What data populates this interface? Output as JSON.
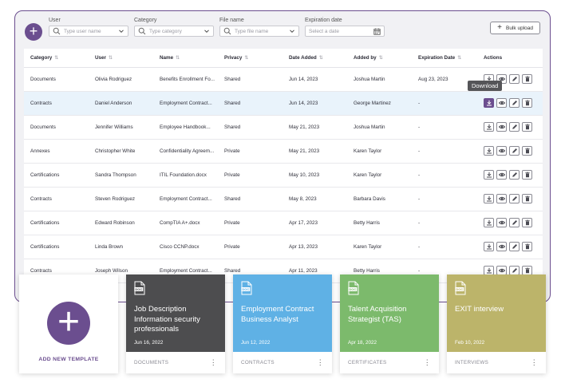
{
  "filters": {
    "user": {
      "label": "User",
      "placeholder": "Type user name"
    },
    "category": {
      "label": "Category",
      "placeholder": "Type category"
    },
    "file_name": {
      "label": "File name",
      "placeholder": "Type file name"
    },
    "expiration": {
      "label": "Expiration date",
      "placeholder": "Select a date"
    }
  },
  "bulk_upload_label": "Bulk upload",
  "columns": [
    "Category",
    "User",
    "Name",
    "Privacy",
    "Date Added",
    "Added by",
    "Expiration Date",
    "Actions"
  ],
  "rows": [
    {
      "category": "Documents",
      "user": "Olivia Rodriguez",
      "name": "Benefits Enrollment Fo...",
      "privacy": "Shared",
      "date_added": "Jun 14, 2023",
      "added_by": "Joshua Martin",
      "expiration": "Aug 23, 2023"
    },
    {
      "category": "Contracts",
      "user": "Daniel Anderson",
      "name": "Employment Contract...",
      "privacy": "Shared",
      "date_added": "Jun 14, 2023",
      "added_by": "George Martinez",
      "expiration": "-"
    },
    {
      "category": "Documents",
      "user": "Jennifer Williams",
      "name": "Employee Handbook...",
      "privacy": "Shared",
      "date_added": "May 21, 2023",
      "added_by": "Joshua Martin",
      "expiration": "-"
    },
    {
      "category": "Annexes",
      "user": "Christopher White",
      "name": "Confidentiality Agreem...",
      "privacy": "Private",
      "date_added": "May 21, 2023",
      "added_by": "Karen Taylor",
      "expiration": "-"
    },
    {
      "category": "Certifications",
      "user": "Sandra Thompson",
      "name": "ITIL Foundation.docx",
      "privacy": "Private",
      "date_added": "May 10, 2023",
      "added_by": "Karen Taylor",
      "expiration": "-"
    },
    {
      "category": "Contracts",
      "user": "Steven Rodriguez",
      "name": "Employment Contract...",
      "privacy": "Shared",
      "date_added": "May 8, 2023",
      "added_by": "Barbara Davis",
      "expiration": "-"
    },
    {
      "category": "Certifications",
      "user": "Edward Robinson",
      "name": "CompTIA A+.docx",
      "privacy": "Private",
      "date_added": "Apr 17, 2023",
      "added_by": "Betty Harris",
      "expiration": "-"
    },
    {
      "category": "Certifications",
      "user": "Linda Brown",
      "name": "Cisco CCNP.docx",
      "privacy": "Private",
      "date_added": "Apr 13, 2023",
      "added_by": "Karen Taylor",
      "expiration": "-"
    },
    {
      "category": "Contracts",
      "user": "Joseph Wilson",
      "name": "Employment Contract...",
      "privacy": "Shared",
      "date_added": "Apr 11, 2023",
      "added_by": "Betty Harris",
      "expiration": "-"
    }
  ],
  "tooltip": "Download",
  "add_template_label": "ADD NEW TEMPLATE",
  "templates": [
    {
      "title": "Job Description Information security professionals",
      "date": "Jun 16, 2022",
      "category": "DOCUMENTS",
      "color": "#4d4d4f"
    },
    {
      "title": "Employment Contract Business Analyst",
      "date": "Jun 12, 2022",
      "category": "CONTRACTS",
      "color": "#5fb1e5"
    },
    {
      "title": "Talent Acquisition Strategist (TAS)",
      "date": "Apr 18, 2022",
      "category": "CERTIFICATES",
      "color": "#7cba6c"
    },
    {
      "title": "EXIT interview",
      "date": "Feb 10, 2022",
      "category": "INTERVIEWS",
      "color": "#bcb46a"
    }
  ],
  "colors": {
    "accent": "#6b4e8f",
    "highlight_row": "#e9f3fb"
  },
  "icons": [
    "plus-icon",
    "search-icon",
    "chevron-down-icon",
    "calendar-icon",
    "sort-icon",
    "download-icon",
    "eye-icon",
    "pencil-icon",
    "trash-icon",
    "doc-icon",
    "kebab-icon"
  ]
}
